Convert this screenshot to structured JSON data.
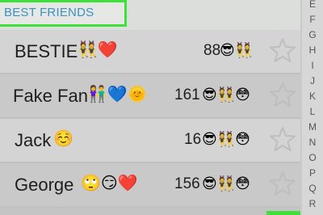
{
  "section": {
    "title": "BEST FRIENDS"
  },
  "friends": [
    {
      "name": "BESTIE",
      "name_emojis": "👯❤️",
      "score": "88",
      "emojis": "😎👯"
    },
    {
      "name": "Fake Fan",
      "name_emojis": "👫💙🌞",
      "score": "161",
      "emojis": "😎👯😳"
    },
    {
      "name": "Jack",
      "name_emojis": "☺️",
      "score": "16",
      "emojis": "😎👯😳"
    },
    {
      "name": "George",
      "name_emojis": "🙄😏❤️",
      "score": "156",
      "emojis": "😎👯😳"
    }
  ],
  "index_letters": [
    "E",
    "F",
    "G",
    "H",
    "I",
    "J",
    "K",
    "L",
    "M",
    "N",
    "O",
    "P",
    "Q",
    "R"
  ],
  "colors": {
    "accent_green": "#3fe03a",
    "section_blue": "#3f8fbf"
  }
}
